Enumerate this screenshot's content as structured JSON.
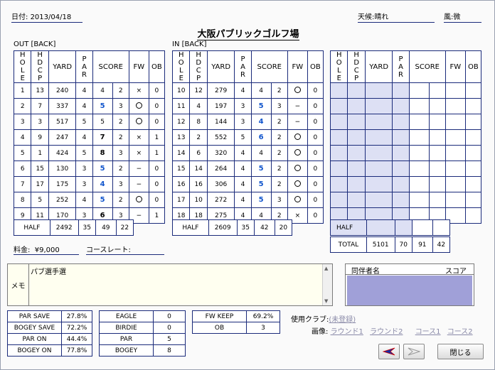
{
  "header": {
    "date_label": "日付:",
    "date": "2013/04/18",
    "weather_label": "天候:",
    "weather": "晴れ",
    "wind_label": "風:",
    "wind": "微"
  },
  "course_name": "大阪パブリックゴルフ場",
  "out_label": "OUT [BACK]",
  "in_label": "IN [BACK]",
  "cols": {
    "hole": "HOLE",
    "hdcp": "HDCP",
    "yard": "YARD",
    "par": "PAR",
    "score": "SCORE",
    "fw": "FW",
    "ob": "OB"
  },
  "out_holes": [
    {
      "hole": "1",
      "hdcp": "13",
      "yard": "240",
      "par": "4",
      "score": "4",
      "putt": "2",
      "fw": "×",
      "ob": "0",
      "style": "n"
    },
    {
      "hole": "2",
      "hdcp": "7",
      "yard": "337",
      "par": "4",
      "score": "5",
      "putt": "3",
      "fw": "○",
      "ob": "0",
      "style": "b"
    },
    {
      "hole": "3",
      "hdcp": "3",
      "yard": "517",
      "par": "5",
      "score": "5",
      "putt": "2",
      "fw": "○",
      "ob": "0",
      "style": "n"
    },
    {
      "hole": "4",
      "hdcp": "9",
      "yard": "247",
      "par": "4",
      "score": "7",
      "putt": "2",
      "fw": "×",
      "ob": "1",
      "style": "k"
    },
    {
      "hole": "5",
      "hdcp": "1",
      "yard": "424",
      "par": "5",
      "score": "8",
      "putt": "3",
      "fw": "×",
      "ob": "1",
      "style": "k"
    },
    {
      "hole": "6",
      "hdcp": "15",
      "yard": "130",
      "par": "3",
      "score": "5",
      "putt": "2",
      "fw": "−",
      "ob": "0",
      "style": "b"
    },
    {
      "hole": "7",
      "hdcp": "17",
      "yard": "175",
      "par": "3",
      "score": "4",
      "putt": "3",
      "fw": "−",
      "ob": "0",
      "style": "b"
    },
    {
      "hole": "8",
      "hdcp": "5",
      "yard": "252",
      "par": "4",
      "score": "5",
      "putt": "2",
      "fw": "○",
      "ob": "0",
      "style": "b"
    },
    {
      "hole": "9",
      "hdcp": "11",
      "yard": "170",
      "par": "3",
      "score": "6",
      "putt": "3",
      "fw": "−",
      "ob": "1",
      "style": "k"
    }
  ],
  "in_holes": [
    {
      "hole": "10",
      "hdcp": "12",
      "yard": "279",
      "par": "4",
      "score": "4",
      "putt": "2",
      "fw": "○",
      "ob": "0",
      "style": "n"
    },
    {
      "hole": "11",
      "hdcp": "4",
      "yard": "197",
      "par": "3",
      "score": "5",
      "putt": "3",
      "fw": "−",
      "ob": "0",
      "style": "b"
    },
    {
      "hole": "12",
      "hdcp": "8",
      "yard": "144",
      "par": "3",
      "score": "4",
      "putt": "2",
      "fw": "−",
      "ob": "0",
      "style": "b"
    },
    {
      "hole": "13",
      "hdcp": "2",
      "yard": "552",
      "par": "5",
      "score": "6",
      "putt": "2",
      "fw": "○",
      "ob": "0",
      "style": "b"
    },
    {
      "hole": "14",
      "hdcp": "6",
      "yard": "320",
      "par": "4",
      "score": "4",
      "putt": "2",
      "fw": "○",
      "ob": "0",
      "style": "n"
    },
    {
      "hole": "15",
      "hdcp": "14",
      "yard": "264",
      "par": "4",
      "score": "5",
      "putt": "2",
      "fw": "○",
      "ob": "0",
      "style": "b"
    },
    {
      "hole": "16",
      "hdcp": "16",
      "yard": "306",
      "par": "4",
      "score": "5",
      "putt": "2",
      "fw": "○",
      "ob": "0",
      "style": "b"
    },
    {
      "hole": "17",
      "hdcp": "10",
      "yard": "272",
      "par": "4",
      "score": "5",
      "putt": "3",
      "fw": "○",
      "ob": "0",
      "style": "b"
    },
    {
      "hole": "18",
      "hdcp": "18",
      "yard": "275",
      "par": "4",
      "score": "4",
      "putt": "2",
      "fw": "×",
      "ob": "0",
      "style": "n"
    }
  ],
  "out_half": {
    "label": "HALF",
    "yard": "2492",
    "par": "35",
    "score": "49",
    "putt": "22"
  },
  "in_half": {
    "label": "HALF",
    "yard": "2609",
    "par": "35",
    "score": "42",
    "putt": "20"
  },
  "third_half": {
    "label": "HALF"
  },
  "total": {
    "label": "TOTAL",
    "yard": "5101",
    "par": "70",
    "score": "91",
    "putt": "42"
  },
  "fee": {
    "label": "料金:",
    "value": "¥9,000"
  },
  "course_rate": {
    "label": "コースレート:",
    "value": ""
  },
  "memo": {
    "label": "メモ",
    "text": "パブ選手選"
  },
  "companions": {
    "name_header": "同伴者名",
    "score_header": "スコア"
  },
  "stats1": [
    {
      "label": "PAR SAVE",
      "value": "27.8%"
    },
    {
      "label": "BOGEY SAVE",
      "value": "72.2%"
    },
    {
      "label": "PAR ON",
      "value": "44.4%"
    },
    {
      "label": "BOGEY ON",
      "value": "77.8%"
    }
  ],
  "stats2": [
    {
      "label": "EAGLE",
      "value": "0"
    },
    {
      "label": "BIRDIE",
      "value": "0"
    },
    {
      "label": "PAR",
      "value": "5"
    },
    {
      "label": "BOGEY",
      "value": "8"
    }
  ],
  "stats3": [
    {
      "label": "FW KEEP",
      "value": "69.2%"
    },
    {
      "label": "OB",
      "value": "3"
    }
  ],
  "club": {
    "label": "使用クラブ:",
    "value": "(未登録)"
  },
  "images": {
    "label": "画像:",
    "links": [
      "ラウンド1",
      "ラウンド2",
      "コース1",
      "コース2"
    ]
  },
  "buttons": {
    "close": "閉じる"
  }
}
